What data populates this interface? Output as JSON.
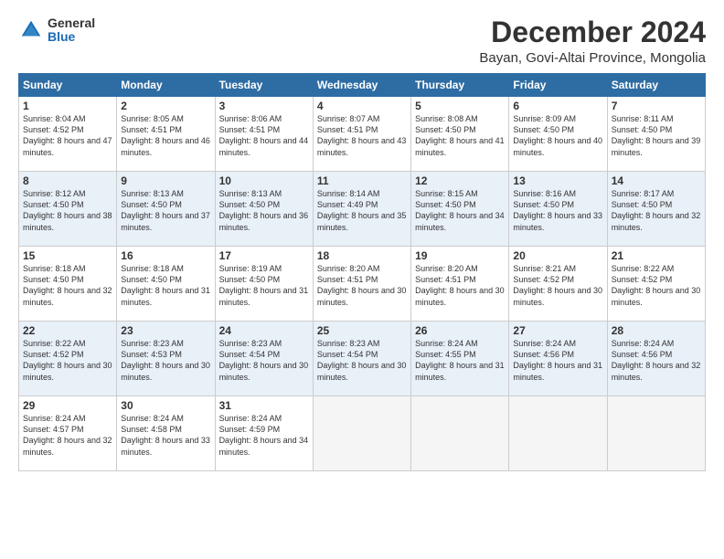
{
  "logo": {
    "general": "General",
    "blue": "Blue"
  },
  "title": "December 2024",
  "location": "Bayan, Govi-Altai Province, Mongolia",
  "headers": [
    "Sunday",
    "Monday",
    "Tuesday",
    "Wednesday",
    "Thursday",
    "Friday",
    "Saturday"
  ],
  "weeks": [
    [
      {
        "day": "1",
        "sunrise": "8:04 AM",
        "sunset": "4:52 PM",
        "daylight": "8 hours and 47 minutes."
      },
      {
        "day": "2",
        "sunrise": "8:05 AM",
        "sunset": "4:51 PM",
        "daylight": "8 hours and 46 minutes."
      },
      {
        "day": "3",
        "sunrise": "8:06 AM",
        "sunset": "4:51 PM",
        "daylight": "8 hours and 44 minutes."
      },
      {
        "day": "4",
        "sunrise": "8:07 AM",
        "sunset": "4:51 PM",
        "daylight": "8 hours and 43 minutes."
      },
      {
        "day": "5",
        "sunrise": "8:08 AM",
        "sunset": "4:50 PM",
        "daylight": "8 hours and 41 minutes."
      },
      {
        "day": "6",
        "sunrise": "8:09 AM",
        "sunset": "4:50 PM",
        "daylight": "8 hours and 40 minutes."
      },
      {
        "day": "7",
        "sunrise": "8:11 AM",
        "sunset": "4:50 PM",
        "daylight": "8 hours and 39 minutes."
      }
    ],
    [
      {
        "day": "8",
        "sunrise": "8:12 AM",
        "sunset": "4:50 PM",
        "daylight": "8 hours and 38 minutes."
      },
      {
        "day": "9",
        "sunrise": "8:13 AM",
        "sunset": "4:50 PM",
        "daylight": "8 hours and 37 minutes."
      },
      {
        "day": "10",
        "sunrise": "8:13 AM",
        "sunset": "4:50 PM",
        "daylight": "8 hours and 36 minutes."
      },
      {
        "day": "11",
        "sunrise": "8:14 AM",
        "sunset": "4:49 PM",
        "daylight": "8 hours and 35 minutes."
      },
      {
        "day": "12",
        "sunrise": "8:15 AM",
        "sunset": "4:50 PM",
        "daylight": "8 hours and 34 minutes."
      },
      {
        "day": "13",
        "sunrise": "8:16 AM",
        "sunset": "4:50 PM",
        "daylight": "8 hours and 33 minutes."
      },
      {
        "day": "14",
        "sunrise": "8:17 AM",
        "sunset": "4:50 PM",
        "daylight": "8 hours and 32 minutes."
      }
    ],
    [
      {
        "day": "15",
        "sunrise": "8:18 AM",
        "sunset": "4:50 PM",
        "daylight": "8 hours and 32 minutes."
      },
      {
        "day": "16",
        "sunrise": "8:18 AM",
        "sunset": "4:50 PM",
        "daylight": "8 hours and 31 minutes."
      },
      {
        "day": "17",
        "sunrise": "8:19 AM",
        "sunset": "4:50 PM",
        "daylight": "8 hours and 31 minutes."
      },
      {
        "day": "18",
        "sunrise": "8:20 AM",
        "sunset": "4:51 PM",
        "daylight": "8 hours and 30 minutes."
      },
      {
        "day": "19",
        "sunrise": "8:20 AM",
        "sunset": "4:51 PM",
        "daylight": "8 hours and 30 minutes."
      },
      {
        "day": "20",
        "sunrise": "8:21 AM",
        "sunset": "4:52 PM",
        "daylight": "8 hours and 30 minutes."
      },
      {
        "day": "21",
        "sunrise": "8:22 AM",
        "sunset": "4:52 PM",
        "daylight": "8 hours and 30 minutes."
      }
    ],
    [
      {
        "day": "22",
        "sunrise": "8:22 AM",
        "sunset": "4:52 PM",
        "daylight": "8 hours and 30 minutes."
      },
      {
        "day": "23",
        "sunrise": "8:23 AM",
        "sunset": "4:53 PM",
        "daylight": "8 hours and 30 minutes."
      },
      {
        "day": "24",
        "sunrise": "8:23 AM",
        "sunset": "4:54 PM",
        "daylight": "8 hours and 30 minutes."
      },
      {
        "day": "25",
        "sunrise": "8:23 AM",
        "sunset": "4:54 PM",
        "daylight": "8 hours and 30 minutes."
      },
      {
        "day": "26",
        "sunrise": "8:24 AM",
        "sunset": "4:55 PM",
        "daylight": "8 hours and 31 minutes."
      },
      {
        "day": "27",
        "sunrise": "8:24 AM",
        "sunset": "4:56 PM",
        "daylight": "8 hours and 31 minutes."
      },
      {
        "day": "28",
        "sunrise": "8:24 AM",
        "sunset": "4:56 PM",
        "daylight": "8 hours and 32 minutes."
      }
    ],
    [
      {
        "day": "29",
        "sunrise": "8:24 AM",
        "sunset": "4:57 PM",
        "daylight": "8 hours and 32 minutes."
      },
      {
        "day": "30",
        "sunrise": "8:24 AM",
        "sunset": "4:58 PM",
        "daylight": "8 hours and 33 minutes."
      },
      {
        "day": "31",
        "sunrise": "8:24 AM",
        "sunset": "4:59 PM",
        "daylight": "8 hours and 34 minutes."
      },
      null,
      null,
      null,
      null
    ]
  ]
}
